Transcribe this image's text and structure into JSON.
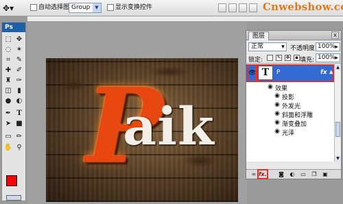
{
  "options_bar": {
    "auto_select_label": "自动选择图层",
    "auto_select_value": "Group",
    "show_transform_label": "显示变换控件",
    "watermark": "Cnwebshow.com"
  },
  "tools": {
    "app_badge": "Ps",
    "items": [
      "move-icon",
      "marquee-icon",
      "lasso-icon",
      "magic-wand-icon",
      "crop-icon",
      "slice-icon",
      "heal-icon",
      "brush-icon",
      "stamp-icon",
      "history-brush-icon",
      "eraser-icon",
      "gradient-icon",
      "blur-icon",
      "dodge-icon",
      "pen-icon",
      "type-icon",
      "path-select-icon",
      "shape-icon",
      "notes-icon",
      "eyedropper-icon",
      "hand-icon",
      "zoom-icon"
    ],
    "foreground_color": "#ff0000",
    "background_color": "#ffffff"
  },
  "canvas": {
    "first_letter": "P",
    "rest_letters": "aik",
    "letter_color": "#e8480f"
  },
  "layers_panel": {
    "tab_title": "图层",
    "close": "x",
    "blend_mode": "正常",
    "opacity_label": "不透明度:",
    "opacity_value": "100%",
    "lock_label": "锁定:",
    "fill_label": "填充:",
    "fill_value": "100%",
    "layer": {
      "thumb": "T",
      "name": "P",
      "fx": "fx"
    },
    "effects_label": "效果",
    "effects": [
      "投影",
      "外发光",
      "斜面和浮雕",
      "渐变叠加",
      "光泽"
    ],
    "bottom_fx": "fx."
  }
}
